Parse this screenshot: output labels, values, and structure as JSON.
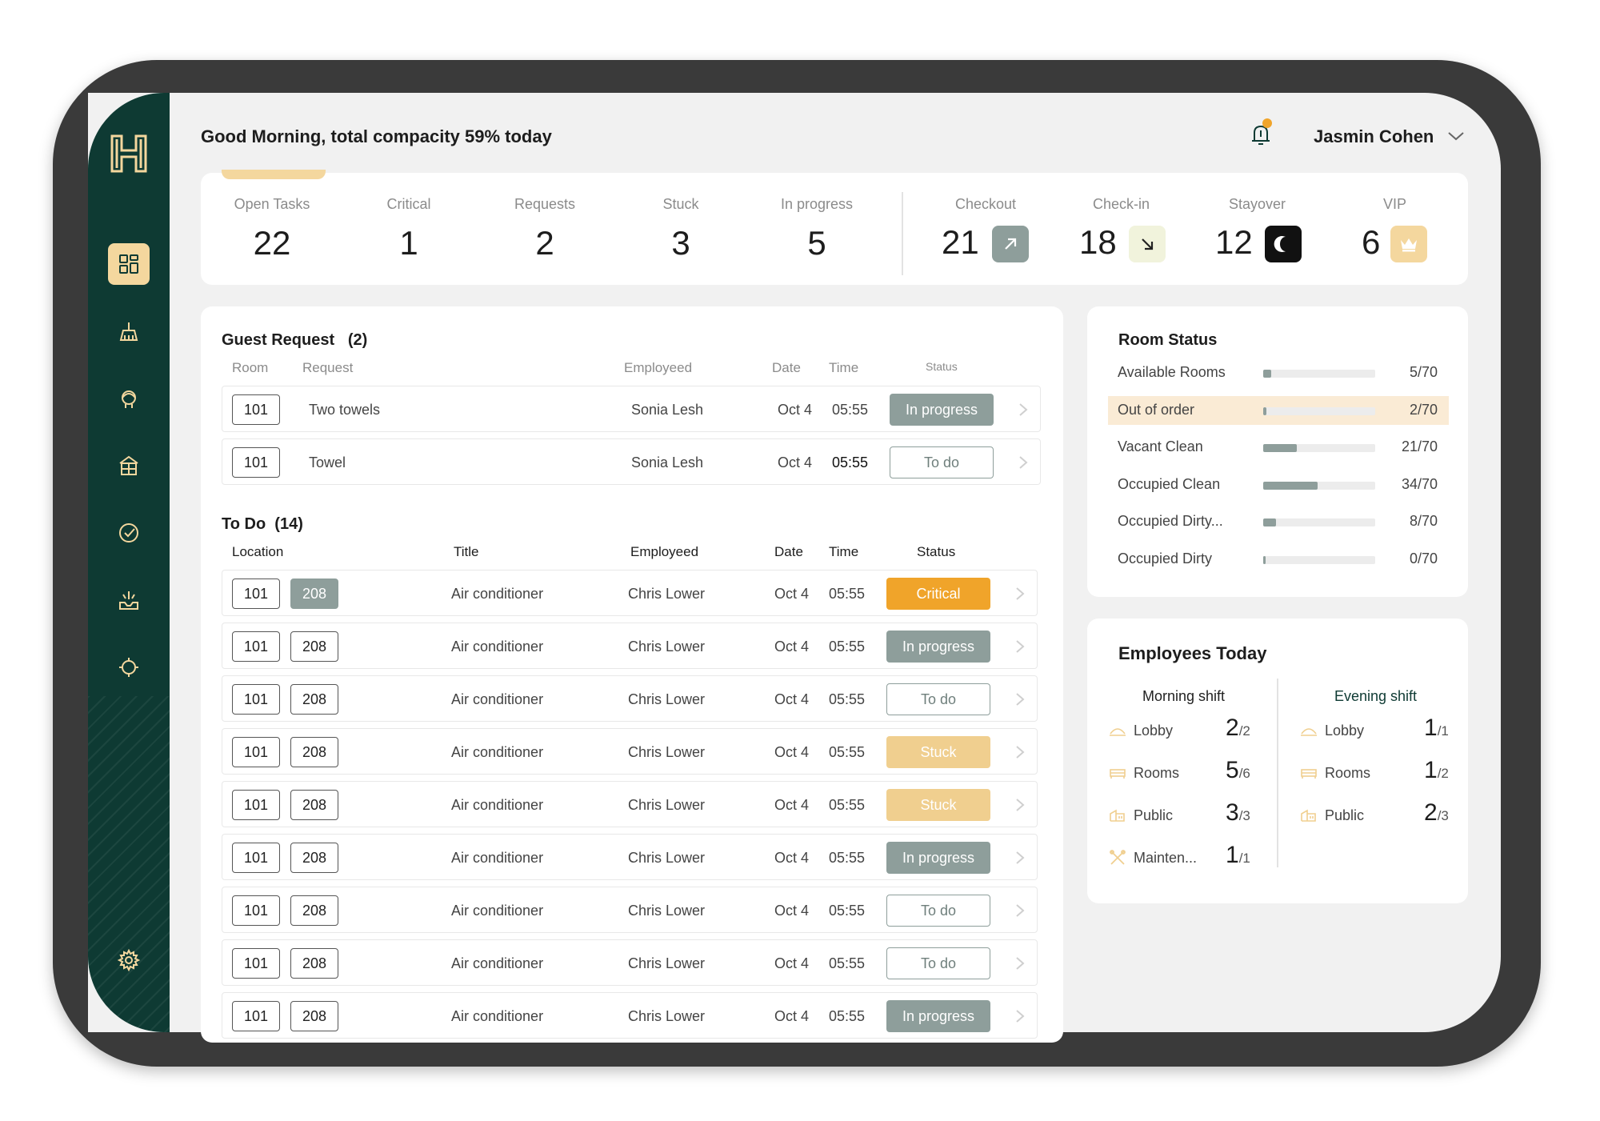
{
  "header": {
    "greeting": "Good Morning, total compacity 59% today",
    "user_name": "Jasmin Cohen"
  },
  "colors": {
    "sidebar": "#0e3a33",
    "accent": "#f4d79e",
    "critical": "#f0a42a",
    "stuck": "#f0cf8f",
    "in_progress": "#8e9e9b"
  },
  "sidebar": {
    "items": [
      {
        "icon": "dashboard-icon"
      },
      {
        "icon": "cleaning-icon"
      },
      {
        "icon": "concierge-icon"
      },
      {
        "icon": "building-icon"
      },
      {
        "icon": "check-circle-icon"
      },
      {
        "icon": "tray-icon"
      },
      {
        "icon": "target-icon"
      },
      {
        "icon": "gear-icon"
      }
    ]
  },
  "stats": {
    "open_tasks": {
      "label": "Open Tasks",
      "value": "22"
    },
    "critical": {
      "label": "Critical",
      "value": "1"
    },
    "requests": {
      "label": "Requests",
      "value": "2"
    },
    "stuck": {
      "label": "Stuck",
      "value": "3"
    },
    "in_progress": {
      "label": "In progress",
      "value": "5"
    },
    "checkout": {
      "label": "Checkout",
      "value": "21",
      "icon": "arrow-up-right-icon"
    },
    "checkin": {
      "label": "Check-in",
      "value": "18",
      "icon": "arrow-down-right-icon"
    },
    "stayover": {
      "label": "Stayover",
      "value": "12",
      "icon": "moon-icon"
    },
    "vip": {
      "label": "VIP",
      "value": "6",
      "icon": "crown-icon"
    }
  },
  "guest_request": {
    "title": "Guest Request",
    "count": "(2)",
    "columns": {
      "room": "Room",
      "request": "Request",
      "employed": "Employeed",
      "date": "Date",
      "time": "Time",
      "status": "Status"
    },
    "rows": [
      {
        "room": "101",
        "request": "Two towels",
        "employee": "Sonia Lesh",
        "date": "Oct 4",
        "time": "05:55",
        "status": "In progress"
      },
      {
        "room": "101",
        "request": "Towel",
        "employee": "Sonia Lesh",
        "date": "Oct 4",
        "time": "05:55",
        "status": "To do"
      }
    ]
  },
  "todo": {
    "title": "To Do",
    "count": "(14)",
    "columns": {
      "location": "Location",
      "title": "Title",
      "employed": "Employeed",
      "date": "Date",
      "time": "Time",
      "status": "Status"
    },
    "rows": [
      {
        "loc1": "101",
        "loc2": "208",
        "title": "Air conditioner",
        "employee": "Chris Lower",
        "date": "Oct 4",
        "time": "05:55",
        "status": "Critical"
      },
      {
        "loc1": "101",
        "loc2": "208",
        "title": "Air conditioner",
        "employee": "Chris Lower",
        "date": "Oct 4",
        "time": "05:55",
        "status": "In progress"
      },
      {
        "loc1": "101",
        "loc2": "208",
        "title": "Air conditioner",
        "employee": "Chris Lower",
        "date": "Oct 4",
        "time": "05:55",
        "status": "To do"
      },
      {
        "loc1": "101",
        "loc2": "208",
        "title": "Air conditioner",
        "employee": "Chris Lower",
        "date": "Oct 4",
        "time": "05:55",
        "status": "Stuck"
      },
      {
        "loc1": "101",
        "loc2": "208",
        "title": "Air conditioner",
        "employee": "Chris Lower",
        "date": "Oct 4",
        "time": "05:55",
        "status": "Stuck"
      },
      {
        "loc1": "101",
        "loc2": "208",
        "title": "Air conditioner",
        "employee": "Chris Lower",
        "date": "Oct 4",
        "time": "05:55",
        "status": "In progress"
      },
      {
        "loc1": "101",
        "loc2": "208",
        "title": "Air conditioner",
        "employee": "Chris Lower",
        "date": "Oct 4",
        "time": "05:55",
        "status": "To do"
      },
      {
        "loc1": "101",
        "loc2": "208",
        "title": "Air conditioner",
        "employee": "Chris Lower",
        "date": "Oct 4",
        "time": "05:55",
        "status": "To do"
      },
      {
        "loc1": "101",
        "loc2": "208",
        "title": "Air conditioner",
        "employee": "Chris Lower",
        "date": "Oct 4",
        "time": "05:55",
        "status": "In progress"
      }
    ]
  },
  "room_status": {
    "title": "Room Status",
    "rows": [
      {
        "label": "Available Rooms",
        "count": "5/70",
        "fraction": 0.0714
      },
      {
        "label": "Out of order",
        "count": "2/70",
        "fraction": 0.0286
      },
      {
        "label": "Vacant  Clean",
        "count": "21/70",
        "fraction": 0.3
      },
      {
        "label": "Occupied Clean",
        "count": "34/70",
        "fraction": 0.4857
      },
      {
        "label": "Occupied Dirty...",
        "count": "8/70",
        "fraction": 0.1143
      },
      {
        "label": "Occupied Dirty",
        "count": "0/70",
        "fraction": 0
      }
    ]
  },
  "employees": {
    "title": "Employees Today",
    "morning": {
      "title": "Morning shift",
      "rows": [
        {
          "label": "Lobby",
          "num": "2",
          "den": "/2",
          "icon": "lobby-icon"
        },
        {
          "label": "Rooms",
          "num": "5",
          "den": "/6",
          "icon": "bed-icon"
        },
        {
          "label": "Public",
          "num": "3",
          "den": "/3",
          "icon": "public-icon"
        },
        {
          "label": "Mainten...",
          "num": "1",
          "den": "/1",
          "icon": "tools-icon"
        }
      ]
    },
    "evening": {
      "title": "Evening shift",
      "rows": [
        {
          "label": "Lobby",
          "num": "1",
          "den": "/1",
          "icon": "lobby-icon"
        },
        {
          "label": "Rooms",
          "num": "1",
          "den": "/2",
          "icon": "bed-icon"
        },
        {
          "label": "Public",
          "num": "2",
          "den": "/3",
          "icon": "public-icon"
        }
      ]
    }
  }
}
